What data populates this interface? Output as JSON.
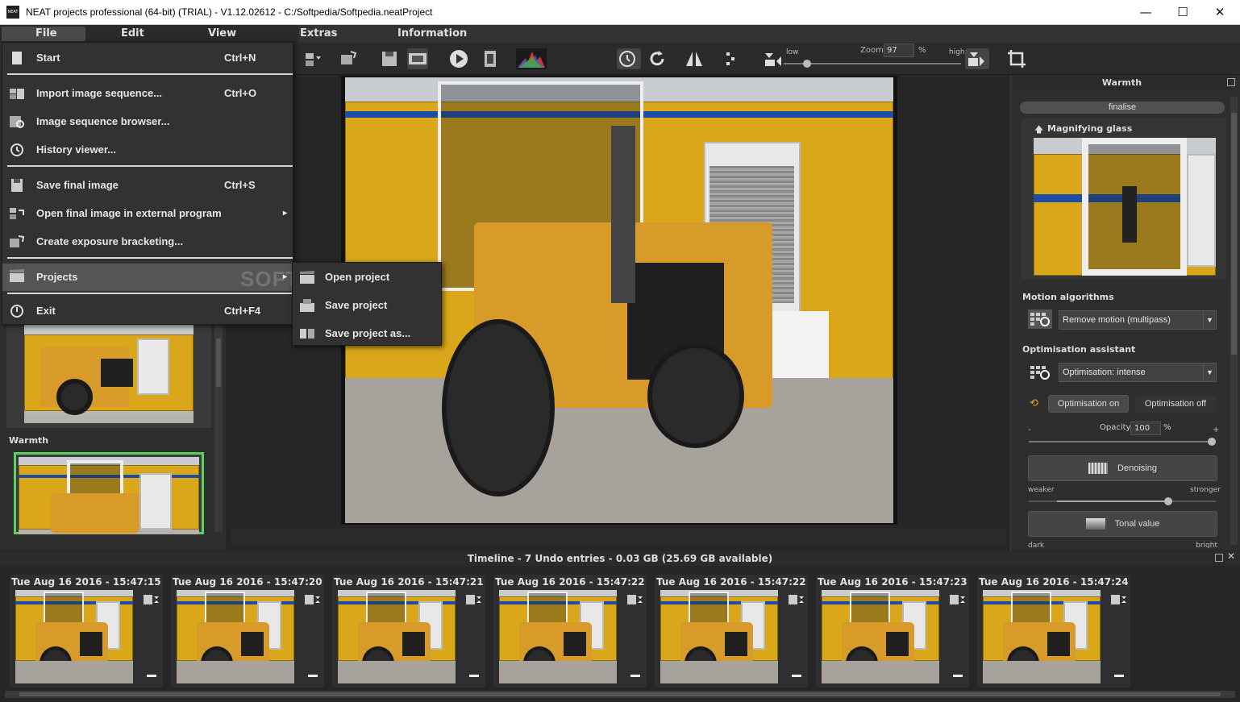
{
  "window": {
    "title": "NEAT projects professional (64-bit) (TRIAL) - V1.12.02612 - C:/Softpedia/Softpedia.neatProject",
    "app_icon": "NEAT",
    "minimize": "—",
    "maximize": "☐",
    "close": "✕"
  },
  "menubar": [
    "File",
    "Edit",
    "View",
    "Extras",
    "Information"
  ],
  "file_menu": {
    "items": [
      {
        "label": "Start",
        "shortcut": "Ctrl+N",
        "icon": "document-icon"
      },
      {
        "label": "Import image sequence...",
        "shortcut": "Ctrl+O",
        "icon": "import-sequence-icon"
      },
      {
        "label": "Image sequence browser...",
        "shortcut": "",
        "icon": "sequence-browser-icon"
      },
      {
        "label": "History viewer...",
        "shortcut": "",
        "icon": "history-icon"
      },
      {
        "label": "Save final image",
        "shortcut": "Ctrl+S",
        "icon": "save-icon"
      },
      {
        "label": "Open final image in external program",
        "shortcut": "",
        "icon": "external-program-icon",
        "submenu_arrow": "▸"
      },
      {
        "label": "Create exposure bracketing...",
        "shortcut": "",
        "icon": "bracketing-icon"
      },
      {
        "label": "Projects",
        "shortcut": "",
        "icon": "clapperboard-icon",
        "submenu_arrow": "▸"
      },
      {
        "label": "Exit",
        "shortcut": "Ctrl+F4",
        "icon": "power-icon"
      }
    ]
  },
  "projects_submenu": [
    {
      "label": "Open project",
      "icon": "open-project-icon"
    },
    {
      "label": "Save project",
      "icon": "save-project-icon"
    },
    {
      "label": "Save project as...",
      "icon": "save-project-as-icon"
    }
  ],
  "watermark": "SOFTPEDIA",
  "toolbar": {
    "zoom_label": "Zoom",
    "zoom_value": "97",
    "zoom_unit": "%",
    "low_label": "low",
    "high_label": "high"
  },
  "left_panel": {
    "warmth_label": "Warmth"
  },
  "right_panel": {
    "header": "Warmth",
    "finalise": "finalise",
    "magnifier_label": "Magnifying glass",
    "motion_title": "Motion algorithms",
    "motion_value": "Remove motion (multipass)",
    "optim_title": "Optimisation assistant",
    "optim_value": "Optimisation: intense",
    "optim_on": "Optimisation on",
    "optim_off": "Optimisation off",
    "opacity_label": "Opacity",
    "opacity_value": "100",
    "opacity_unit": "%",
    "minus": "-",
    "plus": "+",
    "denoising": "Denoising",
    "weaker": "weaker",
    "stronger": "stronger",
    "tonal_value": "Tonal value",
    "dark": "dark",
    "bright": "bright"
  },
  "timeline": {
    "header": "Timeline - 7 Undo entries - 0.03 GB (25.69 GB available)",
    "entries": [
      "Tue Aug 16 2016 - 15:47:15",
      "Tue Aug 16 2016 - 15:47:20",
      "Tue Aug 16 2016 - 15:47:21",
      "Tue Aug 16 2016 - 15:47:22",
      "Tue Aug 16 2016 - 15:47:22",
      "Tue Aug 16 2016 - 15:47:23",
      "Tue Aug 16 2016 - 15:47:24"
    ]
  },
  "colors": {
    "accent_selected": "#5ad35a",
    "background": "#2e2e2e"
  }
}
